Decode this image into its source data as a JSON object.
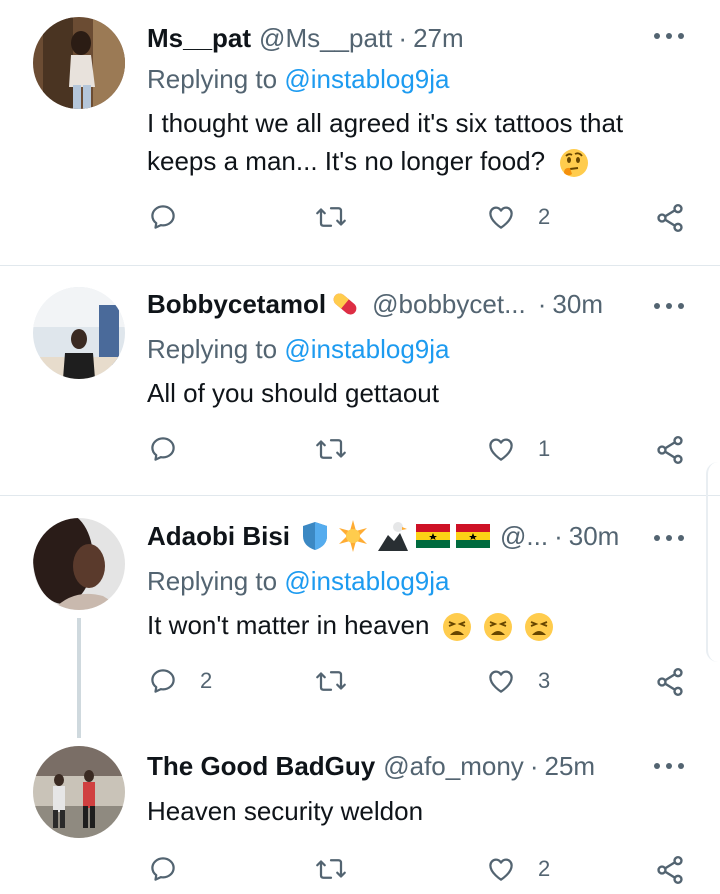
{
  "tweets": [
    {
      "name": "Ms__pat",
      "handle": "@Ms__patt",
      "sep": "·",
      "time": "27m",
      "replying_prefix": "Replying to ",
      "replying_to": "@instablog9ja",
      "text": "I thought we all agreed it's six tattoos that keeps a man... It's no longer food?",
      "text_emojis": [
        "thinking-face"
      ],
      "replies": "",
      "likes": "2",
      "avatar_colors": [
        "#8a6a4a",
        "#d8c0a0"
      ]
    },
    {
      "name": "Bobbycetamol",
      "name_emojis": [
        "pill"
      ],
      "handle": "@bobbycet...",
      "sep": "·",
      "time": "30m",
      "replying_prefix": "Replying to ",
      "replying_to": "@instablog9ja",
      "text": "All of you should gettaout",
      "replies": "",
      "likes": "1",
      "avatar_colors": [
        "#d0d8e0",
        "#2a2a2a"
      ]
    },
    {
      "name": "Adaobi Bisi",
      "name_emojis": [
        "shield",
        "sun",
        "eagle",
        "ghana-flag",
        "ghana-flag"
      ],
      "handle": "@...",
      "sep": "·",
      "time": "30m",
      "replying_prefix": "Replying to ",
      "replying_to": "@instablog9ja",
      "text": "It won't matter in heaven",
      "text_emojis": [
        "tired-face",
        "tired-face",
        "tired-face"
      ],
      "replies": "2",
      "likes": "3",
      "avatar_colors": [
        "#d0d0d0",
        "#3a2a22"
      ]
    },
    {
      "name": "The Good BadGuy",
      "handle": "@afo_mony",
      "sep": "·",
      "time": "25m",
      "text": "Heaven security weldon",
      "replies": "",
      "likes": "2",
      "avatar_colors": [
        "#c8c0b0",
        "#3a3030"
      ]
    }
  ],
  "colors": {
    "link": "#1d9bf0",
    "secondary": "#536471",
    "divider": "#e1e8ed"
  }
}
